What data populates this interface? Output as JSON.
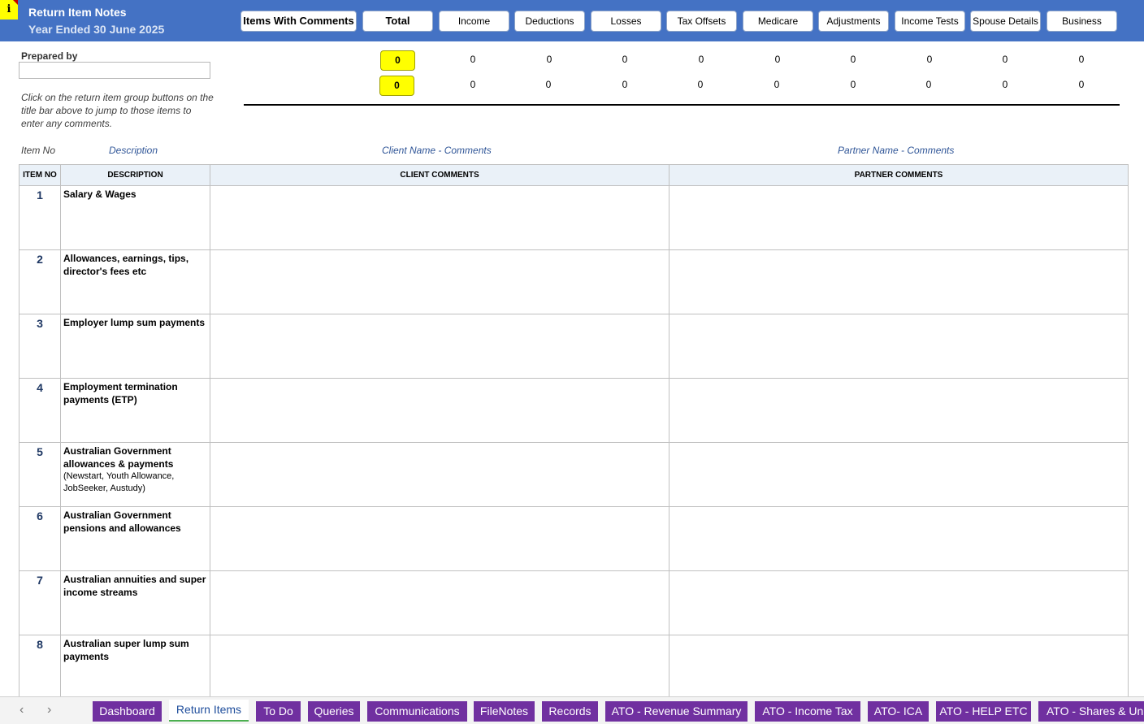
{
  "header": {
    "info_glyph": "i",
    "title": "Return Item Notes",
    "subtitle": "Year Ended 30 June 2025",
    "buttons": [
      {
        "label": "Items With Comments"
      },
      {
        "label": "Total"
      },
      {
        "label": "Income"
      },
      {
        "label": "Deductions"
      },
      {
        "label": "Losses"
      },
      {
        "label": "Tax Offsets"
      },
      {
        "label": "Medicare"
      },
      {
        "label": "Adjustments"
      },
      {
        "label": "Income Tests"
      },
      {
        "label": "Spouse Details"
      },
      {
        "label": "Business"
      }
    ]
  },
  "prepared": {
    "label": "Prepared by",
    "value": ""
  },
  "hint": "Click on the return item group buttons on the title bar above to jump to those items to enter any comments.",
  "counts": {
    "client_total": "0",
    "partner_total": "0",
    "client": [
      "0",
      "0",
      "0",
      "0",
      "0",
      "0",
      "0",
      "0",
      "0"
    ],
    "partner": [
      "0",
      "0",
      "0",
      "0",
      "0",
      "0",
      "0",
      "0",
      "0"
    ]
  },
  "captions": {
    "item_no": "Item No",
    "description": "Description",
    "client": "Client Name - Comments",
    "partner": "Partner Name - Comments"
  },
  "table": {
    "headers": [
      "ITEM NO",
      "DESCRIPTION",
      "CLIENT COMMENTS",
      "PARTNER COMMENTS"
    ],
    "rows": [
      {
        "no": "1",
        "desc": "Salary & Wages",
        "note": "",
        "client": "",
        "partner": ""
      },
      {
        "no": "2",
        "desc": "Allowances, earnings, tips, director's fees etc",
        "note": "",
        "client": "",
        "partner": ""
      },
      {
        "no": "3",
        "desc": "Employer lump sum payments",
        "note": "",
        "client": "",
        "partner": ""
      },
      {
        "no": "4",
        "desc": "Employment termination payments (ETP)",
        "note": "",
        "client": "",
        "partner": ""
      },
      {
        "no": "5",
        "desc": "Australian Government allowances & payments",
        "note": "(Newstart, Youth Allowance, JobSeeker, Austudy)",
        "client": "",
        "partner": ""
      },
      {
        "no": "6",
        "desc": "Australian Government pensions and allowances",
        "note": "",
        "client": "",
        "partner": ""
      },
      {
        "no": "7",
        "desc": "Australian annuities and super income streams",
        "note": "",
        "client": "",
        "partner": ""
      },
      {
        "no": "8",
        "desc": "Australian super lump sum payments",
        "note": "",
        "client": "",
        "partner": ""
      }
    ]
  },
  "tabs": {
    "prev_glyph": "‹",
    "next_glyph": "›",
    "items": [
      {
        "label": "Dashboard"
      },
      {
        "label": "Return Items",
        "active": true
      },
      {
        "label": "To Do"
      },
      {
        "label": "Queries"
      },
      {
        "label": "Communications"
      },
      {
        "label": "FileNotes"
      },
      {
        "label": "Records"
      },
      {
        "label": "ATO - Revenue Summary"
      },
      {
        "label": "ATO - Income Tax"
      },
      {
        "label": "ATO- ICA"
      },
      {
        "label": "ATO - HELP ETC"
      },
      {
        "label": "ATO - Shares & Units"
      }
    ]
  },
  "colors": {
    "header_bg": "#4472c4",
    "tab_bg": "#7030a0",
    "highlight": "#ffff00"
  }
}
